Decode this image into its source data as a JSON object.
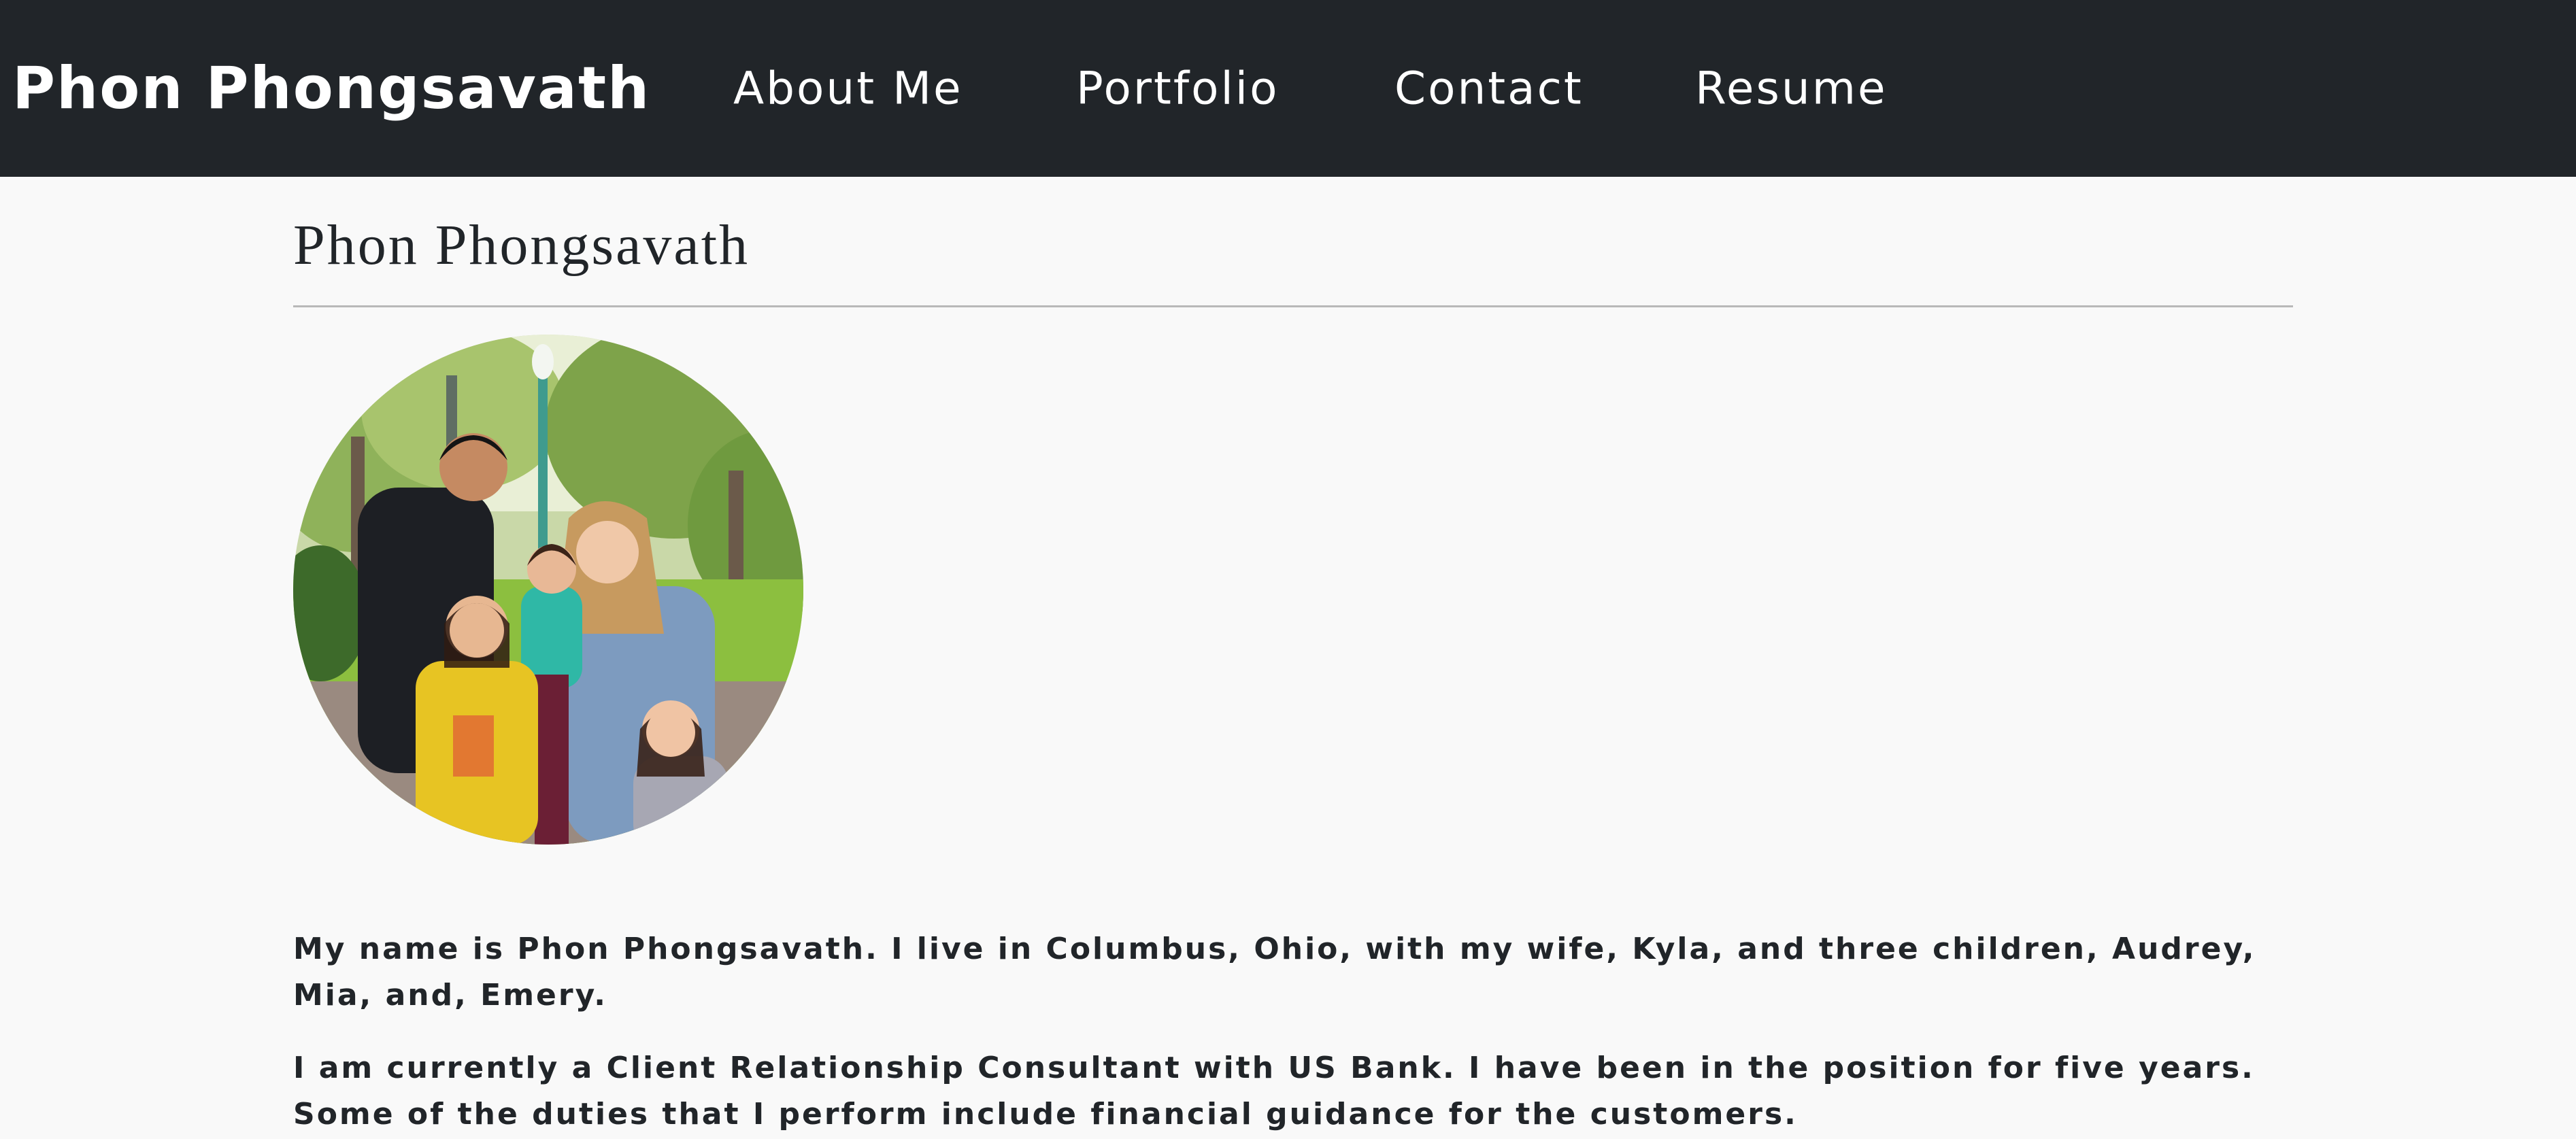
{
  "navbar": {
    "brand": "Phon Phongsavath",
    "links": [
      {
        "label": "About Me"
      },
      {
        "label": "Portfolio"
      },
      {
        "label": "Contact"
      },
      {
        "label": "Resume"
      }
    ],
    "background_color": "#212529",
    "text_color": "#ffffff"
  },
  "main": {
    "title": "Phon Phongsavath",
    "profile_photo": {
      "shape": "circle"
    },
    "paragraphs": [
      "My name is Phon Phongsavath. I live in Columbus, Ohio, with my wife, Kyla, and three children, Audrey, Mia, and, Emery.",
      "I am currently a Client Relationship Consultant with US Bank. I have been in the position for five years. Some of the duties that I perform include financial guidance for the customers."
    ]
  },
  "colors": {
    "page_background": "#f9f9f9",
    "text": "#212529",
    "divider": "#b9b9b9"
  }
}
